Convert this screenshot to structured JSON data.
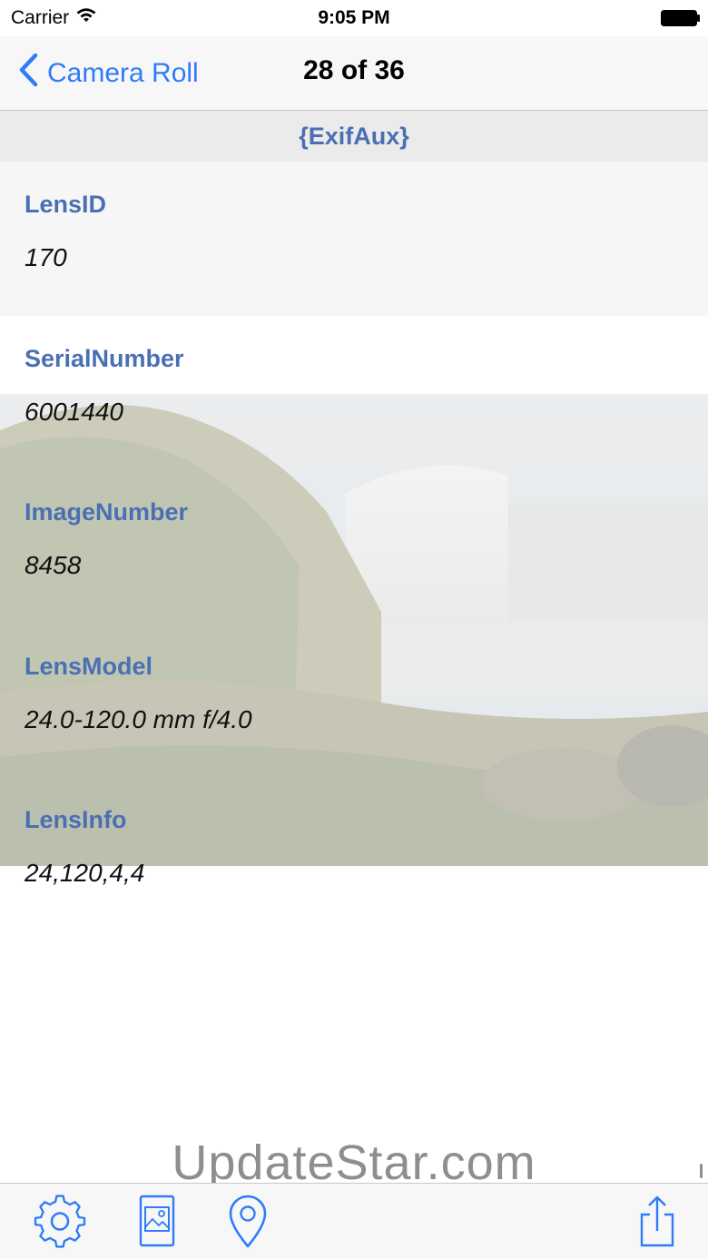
{
  "status_bar": {
    "carrier": "Carrier",
    "time": "9:05 PM"
  },
  "nav": {
    "back_label": "Camera Roll",
    "title": "28 of 36"
  },
  "section": {
    "title": "{ExifAux}"
  },
  "rows": [
    {
      "label": "LensID",
      "value": "170"
    },
    {
      "label": "SerialNumber",
      "value": "6001440"
    },
    {
      "label": "ImageNumber",
      "value": "8458"
    },
    {
      "label": "LensModel",
      "value": "24.0-120.0 mm f/4.0"
    },
    {
      "label": "LensInfo",
      "value": "24,120,4,4"
    }
  ],
  "watermark": "UpdateStar.com",
  "toolbar": {
    "icons": [
      "gear-icon",
      "photo-icon",
      "location-pin-icon",
      "share-icon"
    ]
  },
  "colors": {
    "accent": "#2f7cf6",
    "label": "#4a6fb3"
  }
}
